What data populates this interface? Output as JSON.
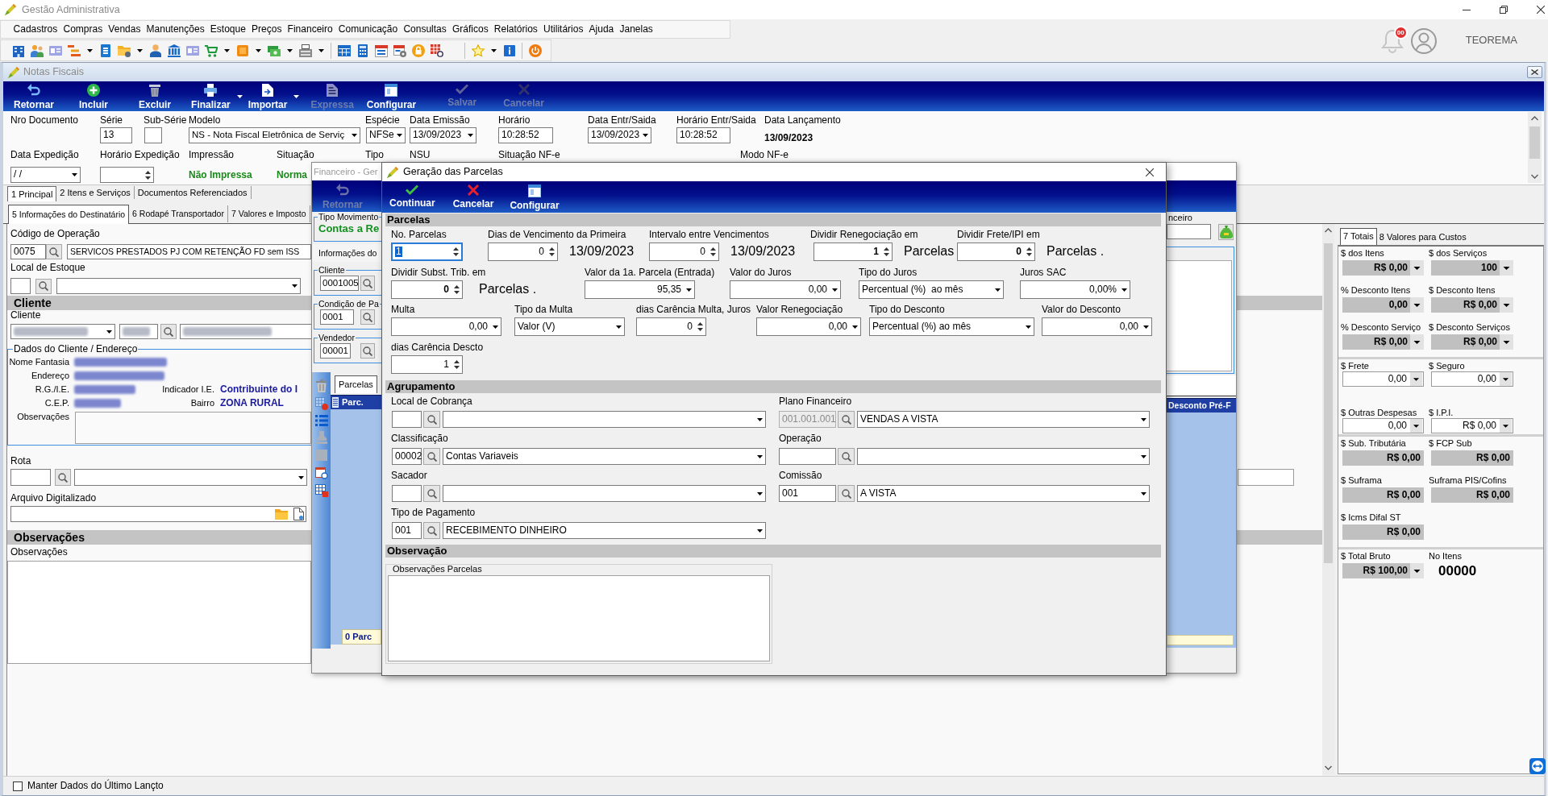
{
  "app": {
    "title": "Gestão Administrativa",
    "notification_count": "00",
    "user": "TEOREMA"
  },
  "menu": [
    "Cadastros",
    "Compras",
    "Vendas",
    "Manutenções",
    "Estoque",
    "Preços",
    "Financeiro",
    "Comunicação",
    "Consultas",
    "Gráficos",
    "Relatórios",
    "Utilitários",
    "Ajuda",
    "Janelas"
  ],
  "notas_fiscais": {
    "title": "Notas Fiscais",
    "toolbar": [
      {
        "label": "Retornar",
        "disabled": false,
        "dropdown": false
      },
      {
        "label": "Incluir",
        "disabled": false,
        "dropdown": false
      },
      {
        "label": "Excluir",
        "disabled": false,
        "dropdown": false
      },
      {
        "label": "Finalizar",
        "disabled": false,
        "dropdown": true
      },
      {
        "label": "Importar",
        "disabled": false,
        "dropdown": true
      },
      {
        "label": "Expressa",
        "disabled": true,
        "dropdown": false
      },
      {
        "label": "Configurar",
        "disabled": false,
        "dropdown": false
      },
      {
        "label": "Salvar",
        "disabled": true,
        "dropdown": false
      },
      {
        "label": "Cancelar",
        "disabled": true,
        "dropdown": false
      }
    ],
    "header_fields": [
      {
        "kind": "label",
        "label": "Nro Documento"
      },
      {
        "kind": "text",
        "label": "Série",
        "value": "13"
      },
      {
        "kind": "text",
        "label": "Sub-Série"
      },
      {
        "kind": "select",
        "label": "Modelo",
        "value": "NS - Nota Fiscal Eletrônica de Serviç"
      },
      {
        "kind": "select",
        "label": "Espécie",
        "value": "NFSe"
      },
      {
        "kind": "select",
        "label": "Data Emissão",
        "value": "13/09/2023"
      },
      {
        "kind": "text",
        "label": "Horário",
        "value": "10:28:52"
      },
      {
        "kind": "select",
        "label": "Data Entr/Saida",
        "value": "13/09/2023"
      },
      {
        "kind": "text",
        "label": "Horário Entr/Saida",
        "value": "10:28:52"
      },
      {
        "kind": "display",
        "label": "Data Lançamento",
        "value": "13/09/2023"
      }
    ],
    "header_fields_2": [
      {
        "kind": "select",
        "label": "Data Expedição",
        "value": "/ /"
      },
      {
        "kind": "spin",
        "label": "Horário Expedição"
      },
      {
        "kind": "status",
        "label": "Impressão",
        "value": "Não Impressa"
      },
      {
        "kind": "status",
        "label": "Situação",
        "value": "Norma"
      },
      {
        "kind": "label",
        "label": "Tipo"
      },
      {
        "kind": "label",
        "label": "NSU"
      },
      {
        "kind": "label",
        "label": "Situação NF-e"
      },
      {
        "kind": "label",
        "label": "Modo NF-e"
      }
    ],
    "tabs": [
      {
        "label": "1 Principal",
        "selected": true
      },
      {
        "label": "2 Itens e Serviços",
        "selected": false
      },
      {
        "label": "Documentos Referenciados",
        "selected": false
      }
    ],
    "subtabs": [
      {
        "label": "5 Informações do Destinatário",
        "selected": true
      },
      {
        "label": "6 Rodapé Transportador",
        "selected": false
      },
      {
        "label": "7 Valores e Imposto",
        "selected": false
      }
    ],
    "operacao": {
      "label": "Código de Operação",
      "code": "0075",
      "description": "SERVICOS PRESTADOS PJ COM RETENÇÃO FD sem ISS"
    },
    "local_estoque": {
      "label": "Local de Estoque"
    },
    "cliente": {
      "section": "Cliente",
      "label": "Cliente",
      "redacted": true
    },
    "dados_cliente": {
      "legend": "Dados do Cliente / Endereço",
      "rows": [
        {
          "label": "Nome Fantasia",
          "redacted": true
        },
        {
          "label": "Endereço",
          "redacted": true
        },
        {
          "label": "R.G./I.E.",
          "redacted": true,
          "extra_label": "Indicador I.E.",
          "extra_value": "Contribuinte do I"
        },
        {
          "label": "C.E.P.",
          "redacted": true,
          "extra_label": "Bairro",
          "extra_value": "ZONA RURAL"
        }
      ],
      "notes_label": "Observações"
    },
    "rota": {
      "label": "Rota"
    },
    "arquivo": {
      "label": "Arquivo Digitalizado"
    },
    "observacoes": {
      "section": "Observações",
      "label": "Observações"
    },
    "manter_dados": {
      "label": "Manter Dados do Último Lançto",
      "checked": false
    },
    "totais": {
      "tabs": [
        {
          "label": "7 Totais",
          "selected": true
        },
        {
          "label": "8 Valores para Custos",
          "selected": false
        }
      ],
      "groups": [
        {
          "items": [
            {
              "label": "$ dos Itens",
              "value": "R$ 0,00",
              "kind": "readonly_dropdown"
            },
            {
              "label": "$ dos Serviços",
              "value": "100",
              "kind": "readonly_dropdown"
            },
            {
              "label": "% Desconto Itens",
              "value": "0,00",
              "kind": "readonly_dropdown"
            },
            {
              "label": "$ Desconto Itens",
              "value": "R$ 0,00",
              "kind": "readonly_dropdown"
            },
            {
              "label": "% Desconto Serviço",
              "value": "R$ 0,00",
              "kind": "readonly_dropdown"
            },
            {
              "label": "$ Desconto Serviços",
              "value": "R$ 0,00",
              "kind": "readonly_dropdown"
            }
          ]
        },
        {
          "items": [
            {
              "label": "$ Frete",
              "value": "0,00",
              "kind": "input_dropdown"
            },
            {
              "label": "$ Seguro",
              "value": "0,00",
              "kind": "input_dropdown"
            },
            {
              "label": "$ Outras Despesas",
              "value": "0,00",
              "kind": "input_dropdown"
            },
            {
              "label": "$ I.P.I.",
              "value": "R$ 0,00",
              "kind": "input_dropdown"
            }
          ]
        },
        {
          "items": [
            {
              "label": "$ Sub. Tributária",
              "value": "R$ 0,00",
              "kind": "readonly"
            },
            {
              "label": "$ FCP Sub",
              "value": "R$ 0,00",
              "kind": "readonly"
            },
            {
              "label": "$ Suframa",
              "value": "R$ 0,00",
              "kind": "readonly"
            },
            {
              "label": "Suframa PIS/Cofins",
              "value": "R$ 0,00",
              "kind": "readonly"
            },
            {
              "label": "$ Icms Difal ST",
              "value": "R$ 0,00",
              "kind": "readonly"
            }
          ]
        },
        {
          "items": [
            {
              "label": "$ Total Bruto",
              "value": "R$ 100,00",
              "kind": "readonly_dropdown"
            },
            {
              "label": "No Itens",
              "value": "00000",
              "kind": "count"
            }
          ]
        }
      ]
    }
  },
  "financeiro": {
    "title": "Financeiro - Ger",
    "toolbar": [
      {
        "label": "Retornar",
        "disabled": true
      }
    ],
    "tipo_movimento": {
      "legend": "Tipo Movimento",
      "value": "Contas a Re"
    },
    "info_label": "Informações do",
    "lookups": [
      {
        "legend": "Cliente",
        "code": "0001005"
      },
      {
        "legend": "Condição de Pa",
        "code": "0001"
      },
      {
        "legend": "Vendedor",
        "code": "00001"
      }
    ],
    "field_label": "nceiro",
    "tabs": [
      {
        "label": "Parcelas",
        "selected": true
      }
    ],
    "grid": {
      "columns": [
        "Parc.",
        "Desconto Pré-F"
      ],
      "footer": "0 Parc"
    }
  },
  "dialog": {
    "title": "Geração das Parcelas",
    "toolbar": [
      {
        "label": "Continuar"
      },
      {
        "label": "Cancelar"
      },
      {
        "label": "Configurar"
      }
    ],
    "parcelas": {
      "title": "Parcelas",
      "rows": [
        [
          {
            "kind": "spin",
            "label": "No. Parcelas",
            "value": "1",
            "focused": true,
            "bold": false
          },
          {
            "kind": "spin",
            "label": "Dias de Vencimento da Primeira",
            "value": "0",
            "suffix": "13/09/2023",
            "focused": false,
            "bold": false
          },
          {
            "kind": "spin",
            "label": "Intervalo entre Vencimentos",
            "value": "0",
            "suffix": "13/09/2023",
            "focused": false,
            "bold": false
          },
          {
            "kind": "spin",
            "label": "Dividir Renegociação em",
            "value": "1",
            "suffix": "Parcelas",
            "focused": false,
            "bold": true
          },
          {
            "kind": "spin",
            "label": "Dividir Frete/IPI em",
            "value": "0",
            "suffix": "Parcelas .",
            "focused": false,
            "bold": true
          }
        ],
        [
          {
            "kind": "spin",
            "label": "Dividir Subst. Trib. em",
            "value": "0",
            "suffix": "Parcelas .",
            "focused": false,
            "bold": true
          },
          {
            "kind": "combo",
            "label": "Valor da 1a. Parcela (Entrada)",
            "value": "95,35",
            "focused": false,
            "bold": false
          },
          {
            "kind": "combo",
            "label": "Valor do Juros",
            "value": "0,00",
            "focused": false,
            "bold": false
          },
          {
            "kind": "select",
            "label": "Tipo do Juros",
            "value": "Percentual (%)  ao mês",
            "focused": false,
            "bold": false
          },
          {
            "kind": "combo",
            "label": "Juros SAC",
            "value": "0,00%",
            "focused": false,
            "bold": false
          }
        ],
        [
          {
            "kind": "combo",
            "label": "Multa",
            "value": "0,00",
            "focused": false,
            "bold": false
          },
          {
            "kind": "select",
            "label": "Tipo da Multa",
            "value": "Valor (V)",
            "focused": false,
            "bold": false
          },
          {
            "kind": "spin",
            "label": "dias Carência Multa, Juros",
            "value": "0",
            "focused": false,
            "bold": false
          },
          {
            "kind": "combo",
            "label": "Valor Renegociação",
            "value": "0,00",
            "focused": false,
            "bold": false
          },
          {
            "kind": "select",
            "label": "Tipo do Desconto",
            "value": "Percentual (%) ao mês",
            "focused": false,
            "bold": false
          },
          {
            "kind": "combo",
            "label": "Valor do Desconto",
            "value": "0,00",
            "focused": false,
            "bold": false
          }
        ],
        [
          {
            "kind": "spin",
            "label": "dias Carência Descto",
            "value": "1",
            "focused": false,
            "bold": false
          }
        ]
      ]
    },
    "agrupamento": {
      "title": "Agrupamento",
      "fields": [
        {
          "label": "Local de Cobrança",
          "code_disabled": false
        },
        {
          "label": "Plano Financeiro",
          "code": "001.001.001",
          "value": "VENDAS A VISTA",
          "code_disabled": true
        },
        {
          "label": "Classificação",
          "code": "00002",
          "value": "Contas Variaveis",
          "code_disabled": false
        },
        {
          "label": "Operação",
          "code_disabled": false
        },
        {
          "label": "Sacador",
          "code_disabled": false
        },
        {
          "label": "Comissão",
          "code": "001",
          "value": "A VISTA",
          "code_disabled": false
        },
        {
          "label": "Tipo de Pagamento",
          "code": "001",
          "value": "RECEBIMENTO DINHEIRO",
          "code_disabled": false
        }
      ]
    },
    "observacao": {
      "title": "Observação",
      "legend": "Observações Parcelas"
    }
  }
}
